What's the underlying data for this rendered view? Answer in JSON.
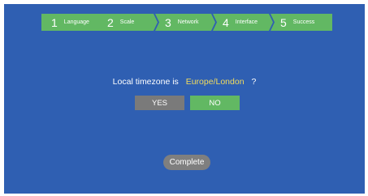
{
  "steps": [
    {
      "number": "1",
      "label": "Language"
    },
    {
      "number": "2",
      "label": "Scale"
    },
    {
      "number": "3",
      "label": "Network"
    },
    {
      "number": "4",
      "label": "Interface"
    },
    {
      "number": "5",
      "label": "Success"
    }
  ],
  "prompt": {
    "prefix": "Local timezone is",
    "timezone": "Europe/London",
    "suffix": "?"
  },
  "buttons": {
    "yes": "YES",
    "no": "NO",
    "complete": "Complete"
  },
  "colors": {
    "background": "#2f5fb2",
    "step": "#62b863",
    "timezone": "#f2dc5d",
    "yes_button": "#7a7a7a",
    "no_button": "#62b863"
  }
}
